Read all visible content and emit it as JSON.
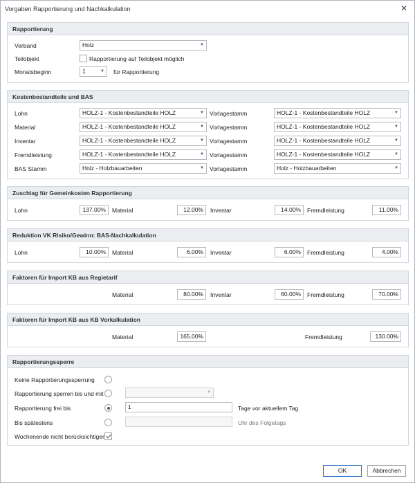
{
  "window": {
    "title": "Vorgaben Rapportierung und Nachkalkulation",
    "close_symbol": "✕"
  },
  "rapportierung": {
    "header": "Rapportierung",
    "verband_label": "Verband",
    "verband_value": "Holz",
    "teilobjekt_label": "Teilobjekt",
    "teilobjekt_checkbox_label": "Rapportierung auf Teilobjekt möglich",
    "teilobjekt_checked": false,
    "monatsbeginn_label": "Monatsbeginn",
    "monatsbeginn_value": "1",
    "monatsbeginn_suffix": "für Rapportierung"
  },
  "kosten": {
    "header": "Kostenbestandteile und BAS",
    "vorlage_label": "Vorlagestamm",
    "rows": [
      {
        "label": "Lohn",
        "value": "HOLZ-1 - Kostenbestandteile HOLZ",
        "vorlage": "HOLZ-1 - Kostenbestandteile HOLZ"
      },
      {
        "label": "Material",
        "value": "HOLZ-1 - Kostenbestandteile HOLZ",
        "vorlage": "HOLZ-1 - Kostenbestandteile HOLZ"
      },
      {
        "label": "Inventar",
        "value": "HOLZ-1 - Kostenbestandteile HOLZ",
        "vorlage": "HOLZ-1 - Kostenbestandteile HOLZ"
      },
      {
        "label": "Fremdleistung",
        "value": "HOLZ-1 - Kostenbestandteile HOLZ",
        "vorlage": "HOLZ-1 - Kostenbestandteile HOLZ"
      },
      {
        "label": "BAS Stamm",
        "value": "Holz - Holzbauarbeiten",
        "vorlage": "Holz - Holzbauarbeiten"
      }
    ]
  },
  "zuschlag": {
    "header": "Zuschlag für Gemeinkosten Rapportierung",
    "lohn_label": "Lohn",
    "lohn": "137.00%",
    "material_label": "Material",
    "material": "12.00%",
    "inventar_label": "Inventar",
    "inventar": "14.00%",
    "fremd_label": "Fremdleistung",
    "fremd": "11.00%"
  },
  "reduktion": {
    "header": "Reduktion VK Risiko/Gewinn: BAS-Nachkalkulation",
    "lohn_label": "Lohn",
    "lohn": "10.00%",
    "material_label": "Material",
    "material": "6.00%",
    "inventar_label": "Inventar",
    "inventar": "6.00%",
    "fremd_label": "Fremdleistung",
    "fremd": "4.00%"
  },
  "regietarif": {
    "header": "Faktoren für Import KB aus Regietarif",
    "material_label": "Material",
    "material": "80.00%",
    "inventar_label": "Inventar",
    "inventar": "60.00%",
    "fremd_label": "Fremdleistung",
    "fremd": "70.00%"
  },
  "vorkalk": {
    "header": "Faktoren für Import KB aus KB Vorkalkulation",
    "material_label": "Material",
    "material": "165.00%",
    "fremd_label": "Fremdleistung",
    "fremd": "130.00%"
  },
  "sperre": {
    "header": "Rapportierungssperre",
    "keine_label": "Keine Rapportierungssperrung",
    "sperren_label": "Rapportierung sperren bis und mit",
    "frei_label": "Rapportierung frei bis",
    "frei_value": "1",
    "frei_suffix": "Tage vor aktuellem Tag",
    "spaetestens_label": "Bis spätestens",
    "spaetestens_suffix": "Uhr des Folgetags",
    "wochenende_label": "Wochenende nicht berücksichtigen",
    "wochenende_checked": true,
    "selected": "frei"
  },
  "buttons": {
    "ok": "OK",
    "cancel": "Abbrechen"
  }
}
